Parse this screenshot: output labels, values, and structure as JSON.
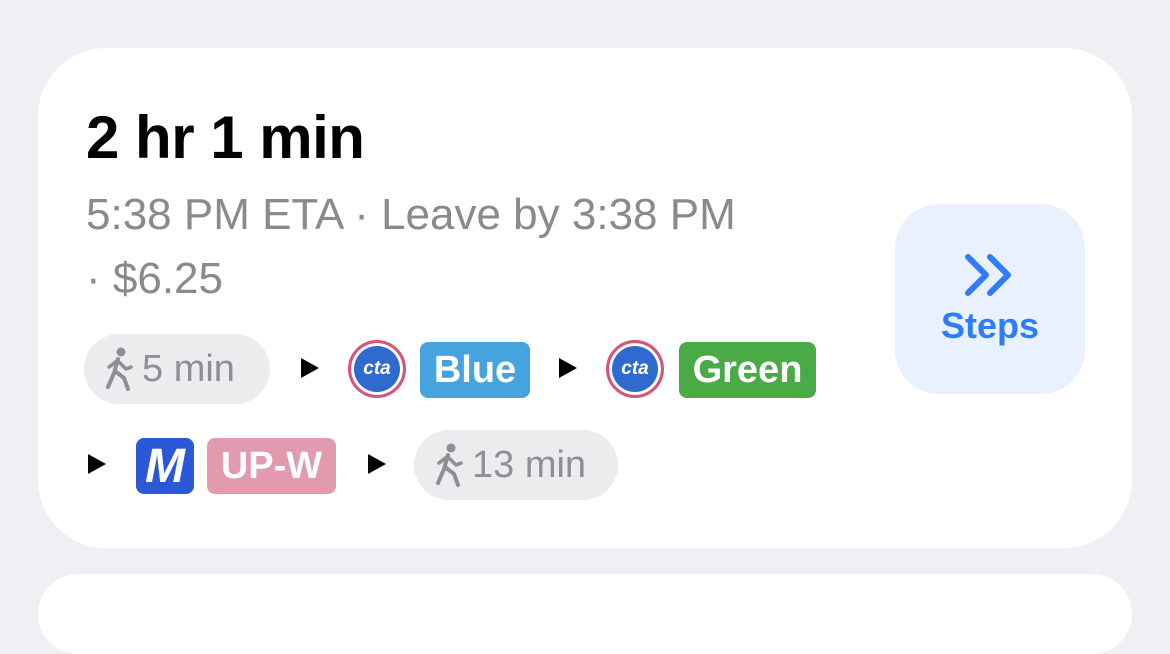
{
  "trip": {
    "duration": "2 hr 1 min",
    "eta_line": "5:38 PM ETA · Leave by 3:38 PM",
    "fare_line": "· $6.25"
  },
  "route": {
    "walk_start": "5 min",
    "cta_label": "cta",
    "blue_line": "Blue",
    "green_line": "Green",
    "metra_label": "M",
    "metra_line": "UP-W",
    "walk_end": "13 min"
  },
  "colors": {
    "blue_line": "#45a4de",
    "green_line": "#4aaa45",
    "metra_line": "#e19aae",
    "cta_blue": "#2f6bcf",
    "cta_ring": "#d7557a",
    "metra_blue": "#2a58d6",
    "accent": "#2f7df6"
  },
  "actions": {
    "steps_label": "Steps",
    "steps_icon": "chevron-double-right-icon"
  }
}
